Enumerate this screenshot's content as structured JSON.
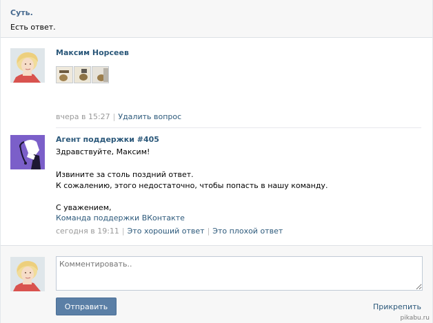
{
  "header": {
    "title": "Суть.",
    "subtitle": "Есть ответ."
  },
  "question": {
    "author": "Максим Норсеев",
    "avatar_icon": "user-avatar-blonde",
    "thumbnails": [
      "photo-thumbnail",
      "photo-thumbnail",
      "photo-thumbnail"
    ],
    "time": "вчера в 15:27",
    "delete_label": "Удалить вопрос"
  },
  "answer": {
    "author": "Агент поддержки #405",
    "avatar_icon": "support-agent-avatar",
    "lines": [
      "Здравствуйте, Максим!",
      "Извините за столь поздний ответ.",
      "К сожалению, этого недостаточно, чтобы попасть в нашу команду.",
      "С уважением,"
    ],
    "signature_link": "Команда поддержки ВКонтакте",
    "time": "сегодня в 19:11",
    "good_label": "Это хороший ответ",
    "bad_label": "Это плохой ответ"
  },
  "compose": {
    "placeholder": "Комментировать..",
    "send_label": "Отправить",
    "attach_label": "Прикрепить"
  },
  "watermark": "pikabu.ru",
  "colors": {
    "link": "#2b587a",
    "button": "#5b7fa6",
    "header_bg": "#f7f7f7"
  }
}
